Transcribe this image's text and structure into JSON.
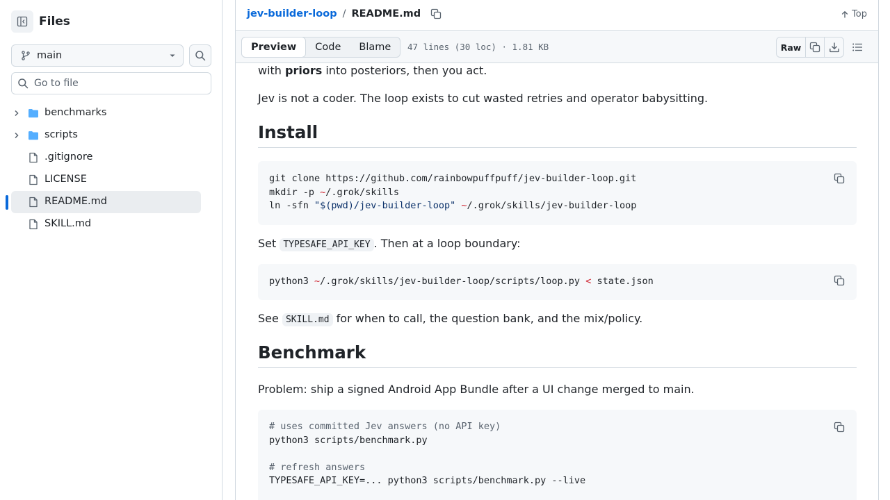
{
  "sidebar": {
    "title": "Files",
    "branch": "main",
    "goto_placeholder": "Go to file",
    "items": [
      {
        "label": "benchmarks",
        "type": "folder"
      },
      {
        "label": "scripts",
        "type": "folder"
      },
      {
        "label": ".gitignore",
        "type": "file"
      },
      {
        "label": "LICENSE",
        "type": "file"
      },
      {
        "label": "README.md",
        "type": "file",
        "selected": true
      },
      {
        "label": "SKILL.md",
        "type": "file"
      }
    ]
  },
  "header": {
    "repo": "jev-builder-loop",
    "separator": "/",
    "file": "README.md",
    "top_label": "Top"
  },
  "toolbar": {
    "tabs": [
      "Preview",
      "Code",
      "Blame"
    ],
    "active_tab": "Preview",
    "meta": "47 lines (30 loc) · 1.81 KB",
    "raw_label": "Raw"
  },
  "content": {
    "p0_pre": "with ",
    "p0_bold": "priors",
    "p0_post": " into posteriors, then you act.",
    "p1": "Jev is not a coder. The loop exists to cut wasted retries and operator babysitting.",
    "h_install": "Install",
    "install_l1": "git clone https://github.com/rainbowpuffpuff/jev-builder-loop.git",
    "install_l2_a": "mkdir -p ",
    "install_l2_tilde": "~",
    "install_l2_b": "/.grok/skills",
    "install_l3_a": "ln -sfn ",
    "install_l3_str": "\"$(pwd)/jev-builder-loop\"",
    "install_l3_sp": " ",
    "install_l3_tilde": "~",
    "install_l3_b": "/.grok/skills/jev-builder-loop",
    "p_set_pre": "Set ",
    "p_set_code": "TYPESAFE_API_KEY",
    "p_set_post": ". Then at a loop boundary:",
    "run_a": "python3 ",
    "run_tilde": "~",
    "run_b": "/.grok/skills/jev-builder-loop/scripts/loop.py ",
    "run_op": "<",
    "run_c": " state.json",
    "p_see_pre": "See ",
    "p_see_code": "SKILL.md",
    "p_see_post": " for when to call, the question bank, and the mix/policy.",
    "h_bench": "Benchmark",
    "p_problem": "Problem: ship a signed Android App Bundle after a UI change merged to main.",
    "bench_l1": "# uses committed Jev answers (no API key)",
    "bench_l2": "python3 scripts/benchmark.py",
    "bench_l4": "# refresh answers",
    "bench_l5": "TYPESAFE_API_KEY=... python3 scripts/benchmark.py --live"
  },
  "colors": {
    "accent": "#0969da",
    "folder": "#54aeff",
    "border": "#d1d9e0",
    "muted": "#59636e"
  },
  "icons": [
    "sidebar-collapse-icon",
    "git-branch-icon",
    "caret-down-icon",
    "search-icon",
    "chevron-right-icon",
    "folder-icon",
    "file-icon",
    "copy-icon",
    "arrow-up-icon",
    "download-icon",
    "list-unordered-icon"
  ]
}
